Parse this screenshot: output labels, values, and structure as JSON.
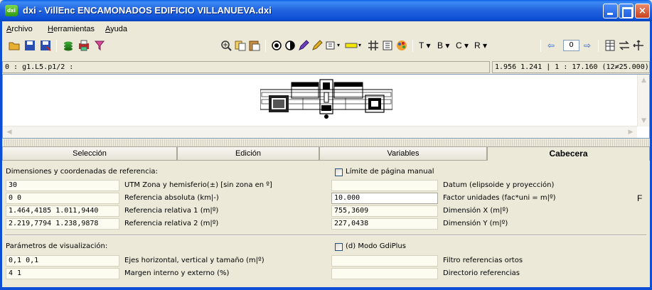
{
  "window": {
    "app_icon_text": "dxi",
    "title": "dxi - VillEnc ENCAMONADOS EDIFICIO VILLANUEVA.dxi",
    "close_glyph": "×"
  },
  "menu": {
    "items": [
      "Archivo",
      "Herramientas",
      "Ayuda"
    ]
  },
  "toolbar": {
    "icons_left": [
      "open-folder-icon",
      "save-icon",
      "save-as-icon",
      "layers-icon",
      "print-icon",
      "filter-icon"
    ],
    "icons_right": [
      "zoom-icon",
      "copy-icon",
      "paste-icon",
      "contrast-icon",
      "invert-icon",
      "pen-icon",
      "eraser-icon",
      "rectangle-icon",
      "color-swatch-icon",
      "grid-icon",
      "frame-icon",
      "palette-icon"
    ],
    "text_buttons": [
      "T ▾",
      "B ▾",
      "C ▾",
      "R ▾"
    ],
    "page_value": "0",
    "nav_prev": "⇦",
    "nav_next": "⇨",
    "extra_icons": [
      "table-icon",
      "arrows-icon",
      "pan-icon"
    ],
    "swatch_color": "#f5e600"
  },
  "status": {
    "path": "0 : g1.L5.p1/2 :",
    "coords": "1.956  1.241 | 1 : 17.160 (12≠25.000)"
  },
  "tabs": {
    "items": [
      "Selección",
      "Edición",
      "Variables",
      "Cabecera"
    ],
    "active": "Cabecera"
  },
  "cabecera": {
    "section1_title": "Dimensiones y coordenadas de referencia:",
    "manual_page_limit_label": "Límite de página manual",
    "rows_left": [
      {
        "value": "30",
        "label": "UTM Zona y hemisferio(±) [sin zona en º]"
      },
      {
        "value": "0  0",
        "label": "Referencia absoluta (km|-)"
      },
      {
        "value": "1.464,4185  1.011,9440",
        "label": "Referencia relativa 1 (m|º)"
      },
      {
        "value": "2.219,7794  1.238,9878",
        "label": "Referencia relativa 2 (m|º)"
      }
    ],
    "rows_right": [
      {
        "value": "",
        "label": "Datum (elipsoide y proyección)"
      },
      {
        "value": "10.000",
        "label": "Factor unidades (fac*uni = m|º)"
      },
      {
        "value": "755,3609",
        "label": "Dimensión X (m|º)"
      },
      {
        "value": "227,0438",
        "label": "Dimensión Y (m|º)"
      }
    ],
    "factor_suffix": "F",
    "section2_title": "Parámetros de visualización:",
    "gdiplus_label": "(d) Modo GdiPlus",
    "rows2_left": [
      {
        "value": "0,1  0,1",
        "label": "Ejes horizontal, vertical y tamaño (m|º)"
      },
      {
        "value": "4  1",
        "label": "Margen interno y externo (%)"
      }
    ],
    "rows2_right": [
      {
        "value": "",
        "label": "Filtro referencias ortos"
      },
      {
        "value": "",
        "label": "Directorio referencias"
      }
    ]
  }
}
